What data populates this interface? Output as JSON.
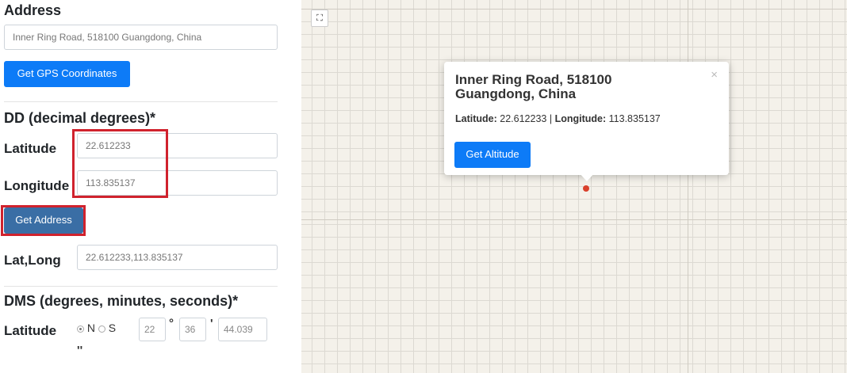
{
  "address": {
    "heading": "Address",
    "value": "Inner Ring Road, 518100 Guangdong, China",
    "get_gps_label": "Get GPS Coordinates"
  },
  "dd": {
    "heading": "DD (decimal degrees)*",
    "latitude_label": "Latitude",
    "latitude_value": "22.612233",
    "longitude_label": "Longitude",
    "longitude_value": "113.835137",
    "get_address_label": "Get Address",
    "latlong_label": "Lat,Long",
    "latlong_value": "22.612233,113.835137"
  },
  "dms": {
    "heading": "DMS (degrees, minutes, seconds)*",
    "latitude_label": "Latitude",
    "north_label": "N",
    "south_label": "S",
    "selected": "N",
    "degrees": "22",
    "minutes": "36",
    "seconds": "44.039",
    "degree_symbol": "°",
    "minute_symbol": "'",
    "second_symbol": "''"
  },
  "map": {
    "fullscreen_icon": "fullscreen-icon",
    "popup": {
      "title": "Inner Ring Road, 518100 Guangdong, China",
      "latitude_label": "Latitude:",
      "latitude_value": "22.612233",
      "separator": "|",
      "longitude_label": "Longitude:",
      "longitude_value": "113.835137",
      "get_altitude_label": "Get Altitude",
      "close_symbol": "×"
    }
  },
  "colors": {
    "button_blue": "#0d7bf7",
    "highlight_red": "#d0222d",
    "marker_red": "#d9402b",
    "map_bg": "#f4f1ea"
  }
}
